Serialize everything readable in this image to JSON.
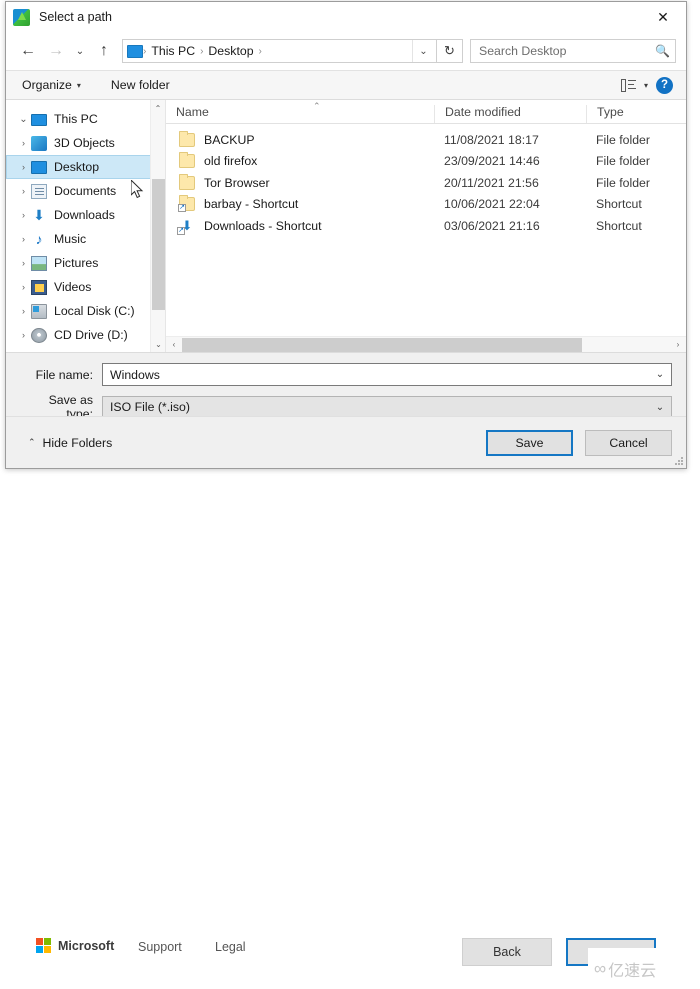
{
  "dialog": {
    "title": "Select a path",
    "title_icon": "app-globe-icon",
    "close_label": "✕"
  },
  "nav": {
    "back_label": "←",
    "forward_label": "→",
    "recent_label": "⌄",
    "up_label": "↑",
    "refresh_label": "↻",
    "address_dropdown": "⌄",
    "breadcrumbs": [
      "This PC",
      "Desktop"
    ],
    "separator": "›"
  },
  "search": {
    "placeholder": "Search Desktop",
    "icon": "🔍"
  },
  "toolbar": {
    "organize_label": "Organize",
    "organize_caret": "▾",
    "new_folder_label": "New folder",
    "view_caret": "▾",
    "help_label": "?"
  },
  "sidebar": {
    "scroll_up": "⌃",
    "scroll_down": "⌄",
    "items": [
      {
        "label": "This PC",
        "twisty": "⌄",
        "icon": "ic-pc",
        "selected": false,
        "root": true
      },
      {
        "label": "3D Objects",
        "twisty": "›",
        "icon": "ic-3d",
        "selected": false,
        "root": false
      },
      {
        "label": "Desktop",
        "twisty": "›",
        "icon": "ic-desk",
        "selected": true,
        "root": false
      },
      {
        "label": "Documents",
        "twisty": "›",
        "icon": "ic-doc",
        "selected": false,
        "root": false
      },
      {
        "label": "Downloads",
        "twisty": "›",
        "icon": "ic-dl",
        "selected": false,
        "root": false
      },
      {
        "label": "Music",
        "twisty": "›",
        "icon": "ic-mus",
        "selected": false,
        "root": false
      },
      {
        "label": "Pictures",
        "twisty": "›",
        "icon": "ic-pic",
        "selected": false,
        "root": false
      },
      {
        "label": "Videos",
        "twisty": "›",
        "icon": "ic-vid",
        "selected": false,
        "root": false
      },
      {
        "label": "Local Disk (C:)",
        "twisty": "›",
        "icon": "ic-disk",
        "selected": false,
        "root": false
      },
      {
        "label": "CD Drive (D:)",
        "twisty": "›",
        "icon": "ic-cd",
        "selected": false,
        "root": false
      }
    ]
  },
  "filelist": {
    "columns": [
      "Name",
      "Date modified",
      "Type"
    ],
    "sort_indicator": "⌃",
    "hscroll_left": "‹",
    "hscroll_right": "›",
    "rows": [
      {
        "name": "BACKUP",
        "date": "11/08/2021 18:17",
        "type": "File folder",
        "icon": "folder"
      },
      {
        "name": "old firefox",
        "date": "23/09/2021 14:46",
        "type": "File folder",
        "icon": "folder"
      },
      {
        "name": "Tor Browser",
        "date": "20/11/2021 21:56",
        "type": "File folder",
        "icon": "folder"
      },
      {
        "name": "barbay - Shortcut",
        "date": "10/06/2021 22:04",
        "type": "Shortcut",
        "icon": "folder-shortcut"
      },
      {
        "name": "Downloads - Shortcut",
        "date": "03/06/2021 21:16",
        "type": "Shortcut",
        "icon": "download-shortcut"
      }
    ]
  },
  "form": {
    "filename_label": "File name:",
    "filename_value": "Windows",
    "savetype_label": "Save as type:",
    "savetype_value": "ISO File (*.iso)",
    "dropdown_caret": "⌄"
  },
  "actions": {
    "hide_folders_label": "Hide Folders",
    "hide_folders_caret": "⌃",
    "save_label": "Save",
    "cancel_label": "Cancel"
  },
  "background": {
    "microsoft_label": "Microsoft",
    "support_label": "Support",
    "legal_label": "Legal",
    "back_label": "Back",
    "watermark_glyph": "∞",
    "watermark_text": "亿速云"
  },
  "colors": {
    "accent": "#1577c4",
    "selection": "#cde8f7",
    "folder": "#fde8ab",
    "help_blue": "#1272c4"
  }
}
